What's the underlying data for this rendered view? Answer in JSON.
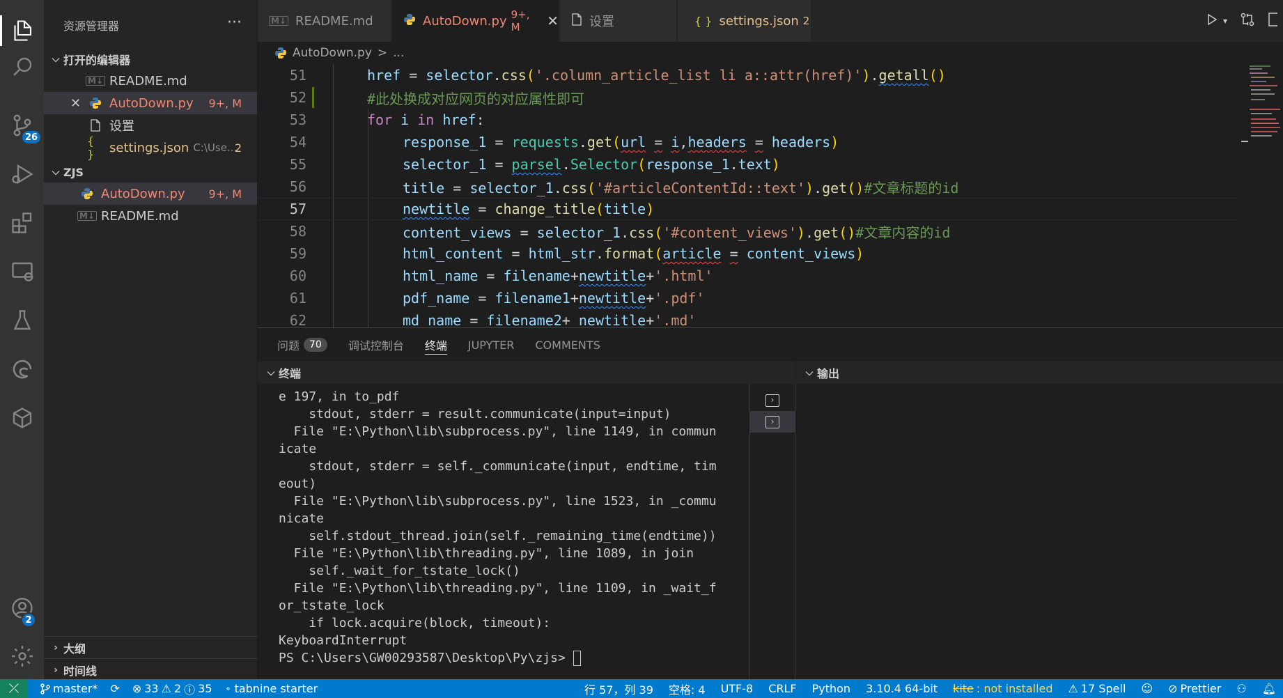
{
  "activity": {
    "scm_badge": "26",
    "account_badge": "2"
  },
  "sidebar": {
    "title": "资源管理器",
    "more": "···",
    "open_editors": {
      "header": "打开的编辑器",
      "items": [
        {
          "label": "README.md",
          "icon": "M↓"
        },
        {
          "label": "AutoDown.py",
          "status": "9+, M"
        },
        {
          "label": "设置"
        },
        {
          "label": "settings.json",
          "desc": "C:\\Use...",
          "status": "2"
        }
      ]
    },
    "workspace": {
      "header": "ZJS",
      "items": [
        {
          "label": "AutoDown.py",
          "status": "9+, M"
        },
        {
          "label": "README.md",
          "icon": "M↓"
        }
      ]
    },
    "outline": "大纲",
    "timeline": "时间线"
  },
  "tabs": [
    {
      "label": "README.md",
      "icon": "M↓"
    },
    {
      "label": "AutoDown.py",
      "status": "9+, M",
      "close": "✕"
    },
    {
      "label": "设置"
    },
    {
      "label": "settings.json",
      "status": "2",
      "icon": "{ }"
    }
  ],
  "breadcrumb": {
    "file": "AutoDown.py",
    "sep": ">",
    "rest": "..."
  },
  "editor": {
    "line_numbers": [
      "51",
      "52",
      "53",
      "54",
      "55",
      "56",
      "57",
      "58",
      "59",
      "60",
      "61",
      "62"
    ],
    "current_line": "57"
  },
  "panel": {
    "tabs": [
      {
        "label": "问题",
        "badge": "70"
      },
      {
        "label": "调试控制台"
      },
      {
        "label": "终端"
      },
      {
        "label": "JUPYTER"
      },
      {
        "label": "COMMENTS"
      }
    ],
    "terminal_header": "终端",
    "output_header": "输出",
    "terminal_lines": [
      "e 197, in to_pdf",
      "    stdout, stderr = result.communicate(input=input)",
      "  File \"E:\\Python\\lib\\subprocess.py\", line 1149, in commun",
      "icate",
      "    stdout, stderr = self._communicate(input, endtime, tim",
      "eout)",
      "  File \"E:\\Python\\lib\\subprocess.py\", line 1523, in _commu",
      "nicate",
      "    self.stdout_thread.join(self._remaining_time(endtime))",
      "  File \"E:\\Python\\lib\\threading.py\", line 1089, in join",
      "    self._wait_for_tstate_lock()",
      "  File \"E:\\Python\\lib\\threading.py\", line 1109, in _wait_f",
      "or_tstate_lock",
      "    if lock.acquire(block, timeout):",
      "KeyboardInterrupt"
    ],
    "prompt": "PS C:\\Users\\GW00293587\\Desktop\\Py\\zjs> "
  },
  "statusbar": {
    "branch": "master*",
    "errors": "33",
    "warnings": "2",
    "infos": "35",
    "tabnine": "tabnine starter",
    "position": "行 57，列 39",
    "spaces": "空格: 4",
    "encoding": "UTF-8",
    "eol": "CRLF",
    "language": "Python",
    "interpreter": "3.10.4 64-bit",
    "kite_name": "kite",
    "kite_status": ": not installed",
    "spell": "17 Spell",
    "prettier": "Prettier"
  }
}
